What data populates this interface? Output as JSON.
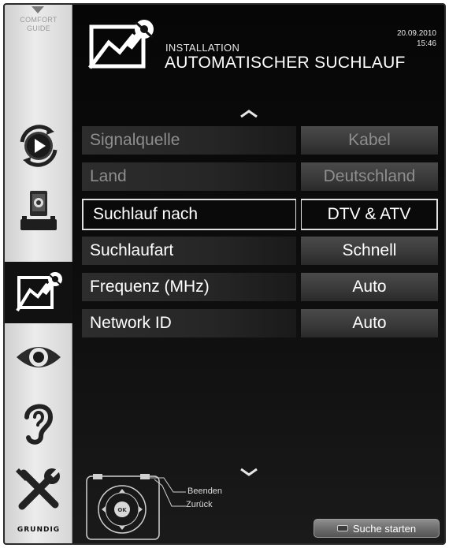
{
  "sidebar": {
    "comfort_guide_line1": "COMFORT",
    "comfort_guide_line2": "GUIDE",
    "items": [
      {
        "name": "playback"
      },
      {
        "name": "sources"
      },
      {
        "name": "installation",
        "active": true
      },
      {
        "name": "picture"
      },
      {
        "name": "sound"
      },
      {
        "name": "tools"
      }
    ],
    "brand": "GRUNDIG"
  },
  "header": {
    "section": "INSTALLATION",
    "title": "AUTOMATISCHER SUCHLAUF",
    "date": "20.09.2010",
    "time": "15:46"
  },
  "rows": [
    {
      "label": "Signalquelle",
      "value": "Kabel",
      "state": "disabled"
    },
    {
      "label": "Land",
      "value": "Deutschland",
      "state": "disabled"
    },
    {
      "label": "Suchlauf nach",
      "value": "DTV & ATV",
      "state": "selected"
    },
    {
      "label": "Suchlaufart",
      "value": "Schnell",
      "state": "normal"
    },
    {
      "label": "Frequenz (MHz)",
      "value": "Auto",
      "state": "normal"
    },
    {
      "label": "Network ID",
      "value": "Auto",
      "state": "normal"
    }
  ],
  "legend": {
    "exit": "Beenden",
    "back": "Zurück",
    "ok": "OK"
  },
  "start_button": {
    "label": "Suche starten"
  },
  "colors": {
    "background": "#0b0b0b",
    "sidebar": "#e4e4e4",
    "row_label": "#262626",
    "row_value": "#404040",
    "selected_border": "#e0e0e0"
  }
}
